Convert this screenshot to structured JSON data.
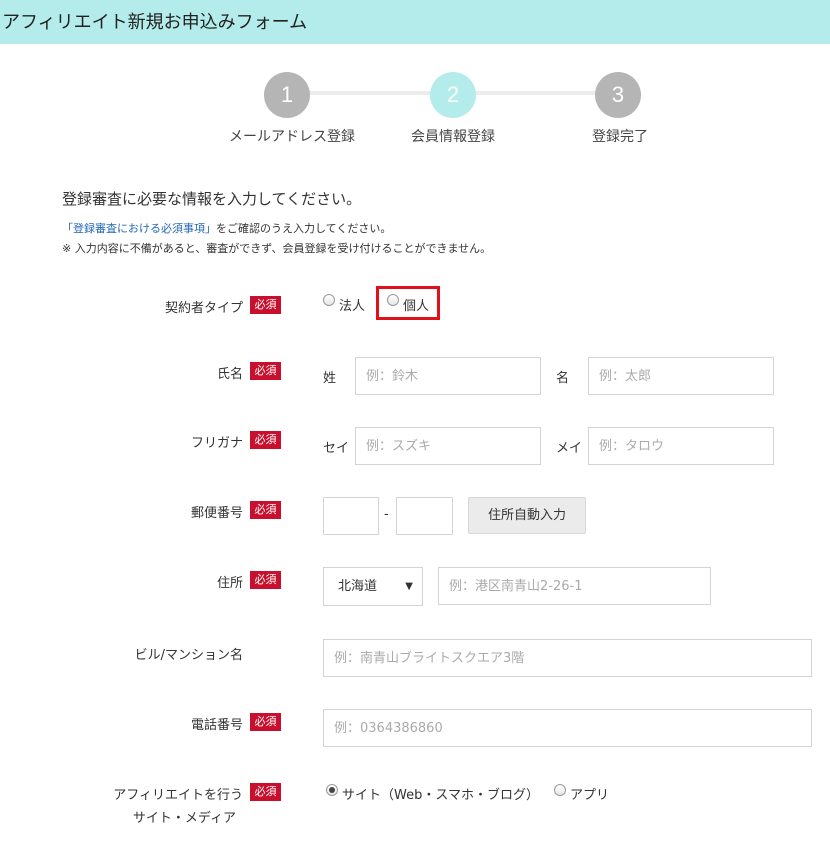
{
  "header": {
    "title": "アフィリエイト新規お申込みフォーム"
  },
  "steps": [
    {
      "number": "1",
      "label": "メールアドレス登録"
    },
    {
      "number": "2",
      "label": "会員情報登録"
    },
    {
      "number": "3",
      "label": "登録完了"
    }
  ],
  "current_step": 2,
  "intro": {
    "heading": "登録審査に必要な情報を入力してください。",
    "note_link": "「登録審査における必須事項」",
    "note_rest": "をご確認のうえ入力してください。",
    "note_warning": "※ 入力内容に不備があると、審査ができず、会員登録を受け付けることができません。"
  },
  "required_badge": "必須",
  "form": {
    "contract_type": {
      "label": "契約者タイプ",
      "options": [
        "法人",
        "個人"
      ]
    },
    "name": {
      "label": "氏名",
      "last_label": "姓",
      "last_placeholder": "例：鈴木",
      "first_label": "名",
      "first_placeholder": "例：太郎"
    },
    "furigana": {
      "label": "フリガナ",
      "last_label": "セイ",
      "last_placeholder": "例：スズキ",
      "first_label": "メイ",
      "first_placeholder": "例：タロウ"
    },
    "postal": {
      "label": "郵便番号",
      "separator": "-",
      "auto_button": "住所自動入力"
    },
    "address": {
      "label": "住所",
      "prefecture": "北海道",
      "placeholder": "例：港区南青山2-26-1"
    },
    "building": {
      "label": "ビル/マンション名",
      "placeholder": "例：南青山ブライトスクエア3階"
    },
    "phone": {
      "label": "電話番号",
      "placeholder": "例：0364386860"
    },
    "media": {
      "label_line1": "アフィリエイトを行う",
      "label_line2": "サイト・メディア",
      "options": [
        "サイト（Web・スマホ・ブログ）",
        "アプリ"
      ],
      "selected": 0
    }
  },
  "colors": {
    "header_bg": "#b3ecea",
    "required_badge": "#c8102e",
    "highlight": "#e0111b",
    "link": "#2468b4"
  }
}
